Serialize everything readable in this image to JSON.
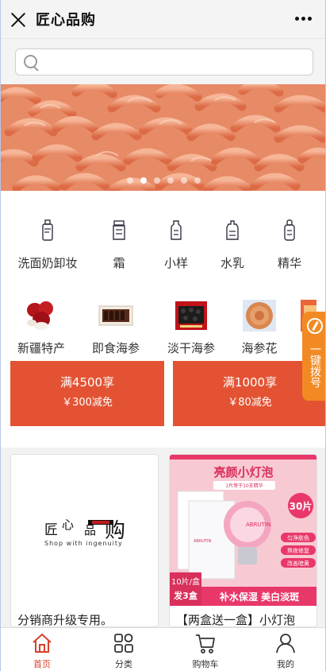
{
  "header": {
    "title": "匠心品购"
  },
  "search": {
    "placeholder": ""
  },
  "banner": {
    "slide_count": 6,
    "active_index": 1
  },
  "categories": [
    {
      "label": "洗面奶卸妆",
      "icon": "bottle-icon"
    },
    {
      "label": "霜",
      "icon": "jar-icon"
    },
    {
      "label": "小样",
      "icon": "sample-icon"
    },
    {
      "label": "水乳",
      "icon": "lotion-icon"
    },
    {
      "label": "精华",
      "icon": "serum-icon"
    }
  ],
  "products": [
    {
      "label": "新疆特产",
      "icon": "jujube-image"
    },
    {
      "label": "即食海参",
      "icon": "sea-cucumber-box-image"
    },
    {
      "label": "淡干海参",
      "icon": "dried-sea-cucumber-image"
    },
    {
      "label": "海参花",
      "icon": "sea-cucumber-flower-image"
    }
  ],
  "coupons": [
    {
      "line1": "满4500享",
      "line2": "￥300减免"
    },
    {
      "line1": "满1000享",
      "line2": "￥80减免"
    }
  ],
  "side_tab": {
    "label": "一键拨号"
  },
  "cards": [
    {
      "title": "分销商升级专用。",
      "logo_text": "匠心品购",
      "logo_sub": "Shop with ingenuity"
    },
    {
      "title": "【两盒送一盒】小灯泡",
      "promo_heading": "亮颜小灯泡",
      "promo_sub": "1片等于10支精华",
      "badge": "30片",
      "pack": "10片/盒",
      "gift": "发3盒",
      "slogan": "补水保湿 美白淡斑",
      "features": [
        "匀净肤色",
        "熬夜修复",
        "改善暗黄"
      ],
      "brand": "ABRUTIN"
    }
  ],
  "tabbar": [
    {
      "label": "首页",
      "icon": "home-icon",
      "active": true
    },
    {
      "label": "分类",
      "icon": "grid-icon",
      "active": false
    },
    {
      "label": "购物车",
      "icon": "cart-icon",
      "active": false
    },
    {
      "label": "我的",
      "icon": "user-icon",
      "active": false
    }
  ],
  "colors": {
    "accent": "#e35333",
    "side_tab": "#f28a24",
    "active_tab": "#d9402b"
  }
}
